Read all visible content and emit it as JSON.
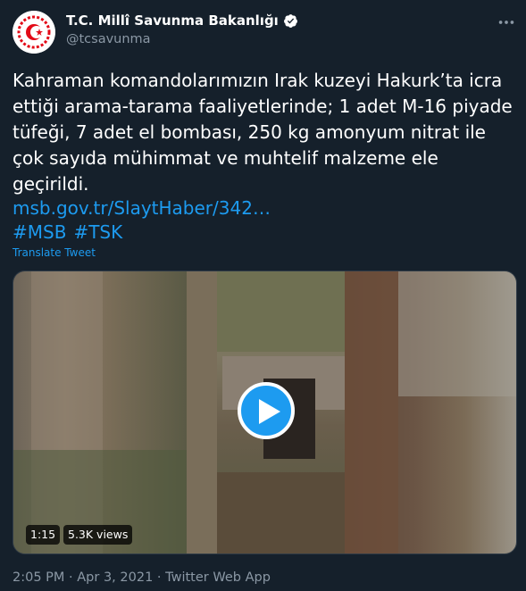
{
  "tweet": {
    "author_name": "T.C. Millî Savunma Bakanlığı",
    "handle": "@tcsavunma",
    "text": "Kahraman komandolarımızın Irak kuzeyi Hakurk’ta icra\nettiği arama-tarama faaliyetlerinde; 1 adet M-16 piyade\ntüfeği, 7 adet el bombası, 250 kg amonyum nitrat ile\nçok sayıda mühimmat ve muhtelif malzeme ele\ngeçirildi.",
    "link": "msb.gov.tr/SlaytHaber/342…",
    "hashtags": [
      "#MSB",
      "#TSK"
    ],
    "translate_label": "Translate Tweet",
    "meta": {
      "time": "2:05 PM",
      "date": "Apr 3, 2021",
      "source": "Twitter Web App",
      "separator": "·"
    }
  },
  "video": {
    "duration": "1:15",
    "views": "5.3K views"
  },
  "colors": {
    "background": "#15202b",
    "accent": "#1d9bf0",
    "secondary_text": "#8b98a5",
    "avatar_red": "#e30a17"
  },
  "icons": [
    "verified-badge-icon",
    "more-options-icon",
    "play-icon",
    "ministry-logo-icon"
  ]
}
